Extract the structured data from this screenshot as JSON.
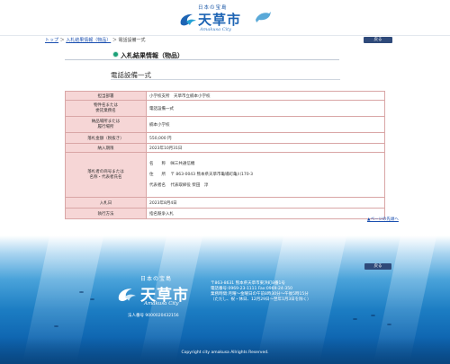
{
  "header": {
    "tagline": "日本の宝島",
    "site_name": "天草市",
    "site_roman": "Amakusa City"
  },
  "breadcrumb": {
    "items": [
      "トップ",
      "入札結果情報（物品）",
      "電話設備一式"
    ],
    "separator": "＞"
  },
  "back_label": "戻る",
  "section_title": "入札結果情報（物品）",
  "item_title": "電話設備一式",
  "table": {
    "rows": [
      {
        "label": "担当部署",
        "value": "小学校支所　天草市立楠本小学校"
      },
      {
        "label": "物件名または\n委託業務名",
        "value": "電話設備一式"
      },
      {
        "label": "納品場所または\n履行場所",
        "value": "楠本小学校"
      },
      {
        "label": "落札金額（税抜き）",
        "value": "550,000 円"
      },
      {
        "label": "納入期限",
        "value": "2023年10月31日"
      },
      {
        "label": "落札者の商号または\n名称・代表者氏名",
        "winner": {
          "name_label": "名　　称",
          "name": "㈱三共通信機",
          "addr_label": "住　　所",
          "addr": "〒 863-0043 熊本県天草市亀場町亀川170-3",
          "rep_label": "代表者名",
          "rep": "代表取締役 柴田　淳"
        }
      },
      {
        "label": "入札日",
        "value": "2023年8月4日"
      },
      {
        "label": "執行方法",
        "value": "指名競争入札"
      }
    ]
  },
  "page_top": "▲ページの先頭へ",
  "footer": {
    "tagline": "日本の宝島",
    "site_name": "天草市",
    "site_roman": "Amakusa City",
    "corp_number": "法人番号 9000020432156",
    "address_lines": [
      "〒863-8631 熊本県天草市東浜町8番1号",
      "電話番号:0969-23-1111  Fax:0969-24-350",
      "業務時間:月曜～金曜日の午前8時30分～午後5時15分",
      "（ただし、祝・休日、12月29日～翌年1月3日を除く）"
    ],
    "copyright": "Copyright city amakusa Allrights Reserved."
  },
  "colors": {
    "brand_blue": "#1d64b4",
    "table_header_bg": "#f6d6d6",
    "table_border": "#d9a6a6",
    "button_bg": "#2f4a7a",
    "bullet_green": "#1aa078"
  }
}
